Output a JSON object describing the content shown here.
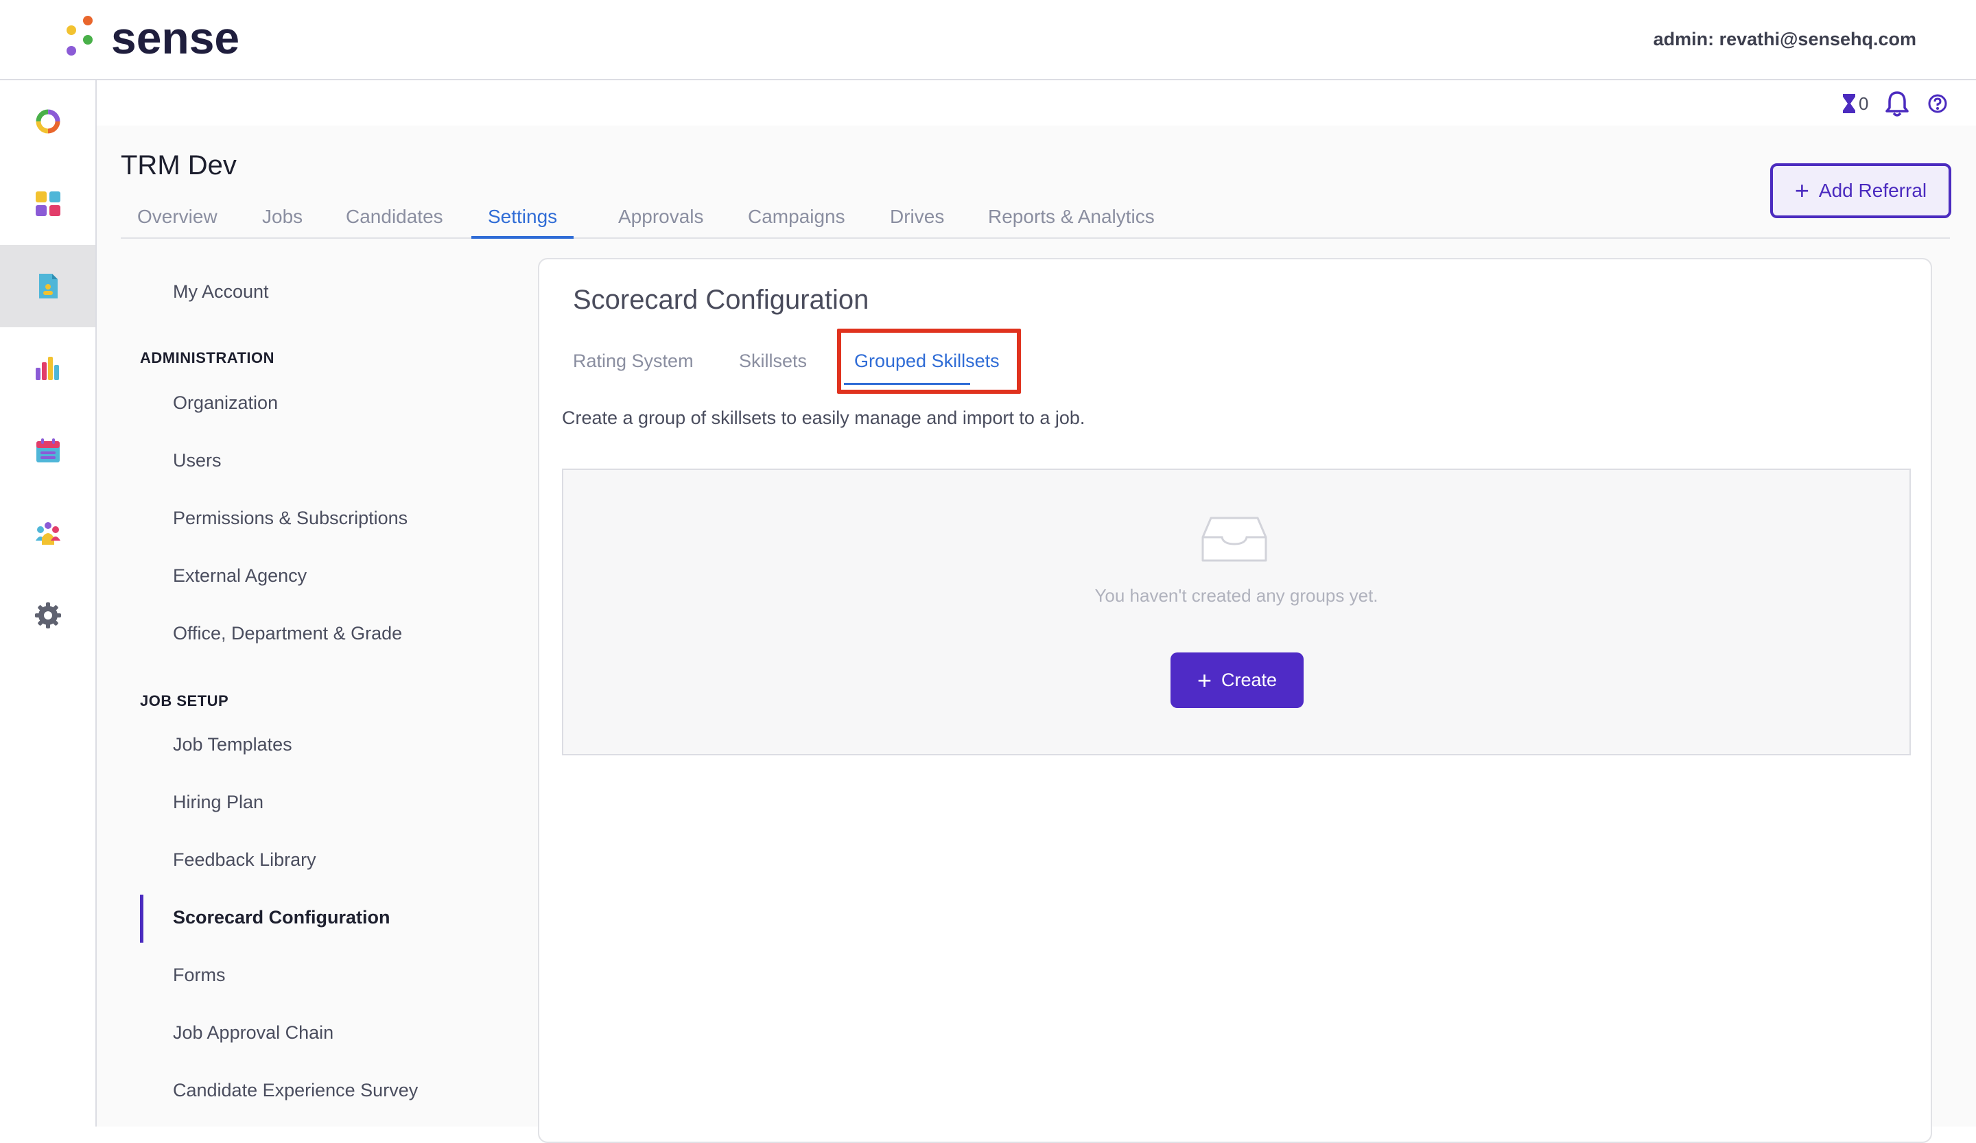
{
  "header": {
    "logo_text": "sense",
    "admin_email": "admin: revathi@sensehq.com"
  },
  "rail": {
    "items": [
      {
        "icon": "ring-icon",
        "active": false
      },
      {
        "icon": "dashboard-grid-icon",
        "active": false
      },
      {
        "icon": "document-icon",
        "active": true
      },
      {
        "icon": "bar-chart-icon",
        "active": false
      },
      {
        "icon": "calendar-icon",
        "active": false
      },
      {
        "icon": "people-icon",
        "active": false
      },
      {
        "icon": "gear-icon",
        "active": false
      }
    ]
  },
  "utility": {
    "pending_count": "0"
  },
  "project": {
    "title": "TRM Dev",
    "add_referral_label": "Add Referral"
  },
  "main_tabs": [
    {
      "label": "Overview",
      "active": false
    },
    {
      "label": "Jobs",
      "active": false
    },
    {
      "label": "Candidates",
      "active": false
    },
    {
      "label": "Settings",
      "active": true
    },
    {
      "label": "Approvals",
      "active": false
    },
    {
      "label": "Campaigns",
      "active": false
    },
    {
      "label": "Drives",
      "active": false
    },
    {
      "label": "Reports & Analytics",
      "active": false
    }
  ],
  "settings_nav": {
    "my_account": "My Account",
    "administration_heading": "ADMINISTRATION",
    "administration": [
      "Organization",
      "Users",
      "Permissions & Subscriptions",
      "External Agency",
      "Office, Department & Grade"
    ],
    "job_setup_heading": "JOB SETUP",
    "job_setup": [
      "Job Templates",
      "Hiring Plan",
      "Feedback Library",
      "Scorecard Configuration",
      "Forms",
      "Job Approval Chain",
      "Candidate Experience Survey"
    ],
    "active_item": "Scorecard Configuration"
  },
  "card": {
    "title": "Scorecard Configuration",
    "sub_tabs": [
      {
        "label": "Rating System",
        "active": false
      },
      {
        "label": "Skillsets",
        "active": false
      },
      {
        "label": "Grouped Skillsets",
        "active": true
      }
    ],
    "description": "Create a group of skillsets to easily manage and import to a job.",
    "empty_message": "You haven't created any groups yet.",
    "create_label": "Create"
  },
  "colors": {
    "accent_purple": "#4f2bc6",
    "active_tab_blue": "#2f6cd6",
    "highlight_red": "#e0321e"
  }
}
